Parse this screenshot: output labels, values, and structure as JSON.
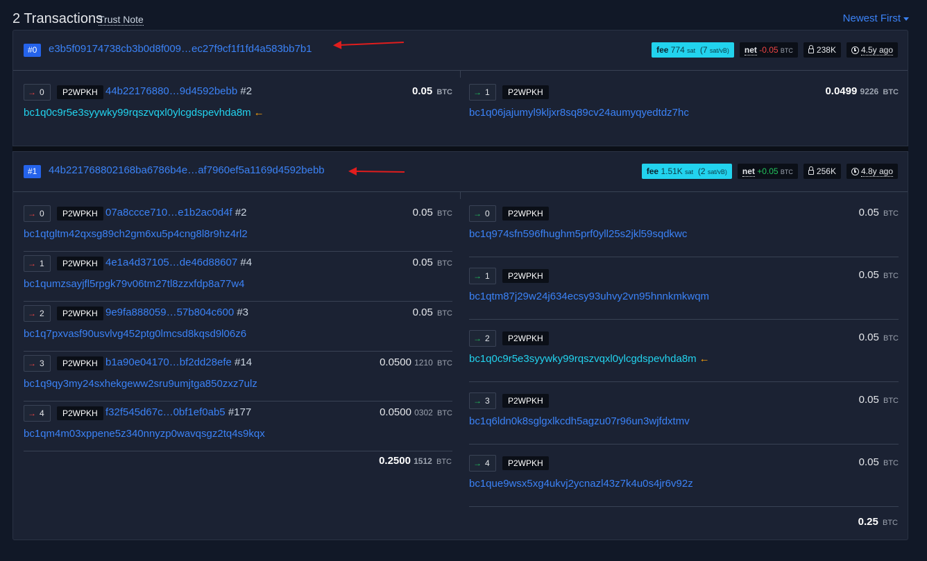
{
  "header": {
    "count": "2 Transactions",
    "trust_note": "Trust Note",
    "sort": "Newest First"
  },
  "transactions": [
    {
      "index": "#0",
      "txid": "e3b5f09174738cb3b0d8f009…ec27f9cf1f1fd4a583bb7b1",
      "fee_label": "fee",
      "fee": "774",
      "fee_unit": "sat",
      "fee_rate": "(7",
      "fee_rate_unit": "sat/vB)",
      "net_label": "net",
      "net": "-0.05",
      "net_unit": "BTC",
      "size": "238K",
      "age": "4.5y ago",
      "inputs": [
        {
          "idx": "0",
          "type": "P2WPKH",
          "prev": "44b22176880…9d4592bebb",
          "vout": "#2",
          "amount": "0.05",
          "amount_sub": "",
          "unit": "BTC",
          "address": "bc1q0c9r5e3syywky99rqszvqxl0ylcgdspevhda8m",
          "back_icon": "←"
        }
      ],
      "outputs": [
        {
          "idx": "1",
          "type": "P2WPKH",
          "amount": "0.0499",
          "amount_sub": "9226",
          "unit": "BTC",
          "address": "bc1q06jajumyl9kljxr8sq89cv24aumyqyedtdz7hc"
        }
      ]
    },
    {
      "index": "#1",
      "txid": "44b221768802168ba6786b4e…af7960ef5a1169d4592bebb",
      "fee_label": "fee",
      "fee": "1.51K",
      "fee_unit": "sat",
      "fee_rate": "(2",
      "fee_rate_unit": "sat/vB)",
      "net_label": "net",
      "net": "+0.05",
      "net_unit": "BTC",
      "size": "256K",
      "age": "4.8y ago",
      "inputs": [
        {
          "idx": "0",
          "type": "P2WPKH",
          "prev": "07a8ccce710…e1b2ac0d4f",
          "vout": "#2",
          "amount": "0.05",
          "amount_sub": "",
          "unit": "BTC",
          "address": "bc1qtgltm42qxsg89ch2gm6xu5p4cng8l8r9hz4rl2"
        },
        {
          "idx": "1",
          "type": "P2WPKH",
          "prev": "4e1a4d37105…de46d88607",
          "vout": "#4",
          "amount": "0.05",
          "amount_sub": "",
          "unit": "BTC",
          "address": "bc1qumzsayjfl5rpgk79v06tm27tl8zzxfdp8a77w4"
        },
        {
          "idx": "2",
          "type": "P2WPKH",
          "prev": "9e9fa888059…57b804c600",
          "vout": "#3",
          "amount": "0.05",
          "amount_sub": "",
          "unit": "BTC",
          "address": "bc1q7pxvasf90usvlvg452ptg0lmcsd8kqsd9l06z6"
        },
        {
          "idx": "3",
          "type": "P2WPKH",
          "prev": "b1a90e04170…bf2dd28efe",
          "vout": "#14",
          "amount": "0.0500",
          "amount_sub": "1210",
          "unit": "BTC",
          "address": "bc1q9qy3my24sxhekgeww2sru9umjtga850zxz7ulz"
        },
        {
          "idx": "4",
          "type": "P2WPKH",
          "prev": "f32f545d67c…0bf1ef0ab5",
          "vout": "#177",
          "amount": "0.0500",
          "amount_sub": "0302",
          "unit": "BTC",
          "address": "bc1qm4m03xppene5z340nnyzp0wavqsgz2tq4s9kqx"
        }
      ],
      "inputs_total": "0.2500",
      "inputs_total_sub": "1512",
      "inputs_total_unit": "BTC",
      "outputs": [
        {
          "idx": "0",
          "type": "P2WPKH",
          "amount": "0.05",
          "amount_sub": "",
          "unit": "BTC",
          "address": "bc1q974sfn596fhughm5prf0yll25s2jkl59sqdkwc"
        },
        {
          "idx": "1",
          "type": "P2WPKH",
          "amount": "0.05",
          "amount_sub": "",
          "unit": "BTC",
          "address": "bc1qtm87j29w24j634ecsy93uhvy2vn95hnnkmkwqm"
        },
        {
          "idx": "2",
          "type": "P2WPKH",
          "amount": "0.05",
          "amount_sub": "",
          "unit": "BTC",
          "address": "bc1q0c9r5e3syywky99rqszvqxl0ylcgdspevhda8m",
          "back_icon": "←"
        },
        {
          "idx": "3",
          "type": "P2WPKH",
          "amount": "0.05",
          "amount_sub": "",
          "unit": "BTC",
          "address": "bc1q6ldn0k8sglgxlkcdh5agzu07r96un3wjfdxtmv"
        },
        {
          "idx": "4",
          "type": "P2WPKH",
          "amount": "0.05",
          "amount_sub": "",
          "unit": "BTC",
          "address": "bc1que9wsx5xg4ukvj2ycnazl43z7k4u0s4jr6v92z"
        }
      ],
      "outputs_total": "0.25",
      "outputs_total_unit": "BTC"
    }
  ],
  "icons": {
    "input_arrow": "→",
    "output_arrow": "→",
    "back": "arrow-left-icon",
    "lock": "lock-icon",
    "clock": "clock-icon",
    "annotation": "red-arrow-annotation"
  },
  "colors": {
    "bg": "#111827",
    "card": "#1b2233",
    "link": "#3b82f6",
    "self": "#22d3ee",
    "fee": "#22d3ee",
    "neg": "#ef4444",
    "pos": "#22c55e",
    "annotation": "#e11d1d"
  }
}
